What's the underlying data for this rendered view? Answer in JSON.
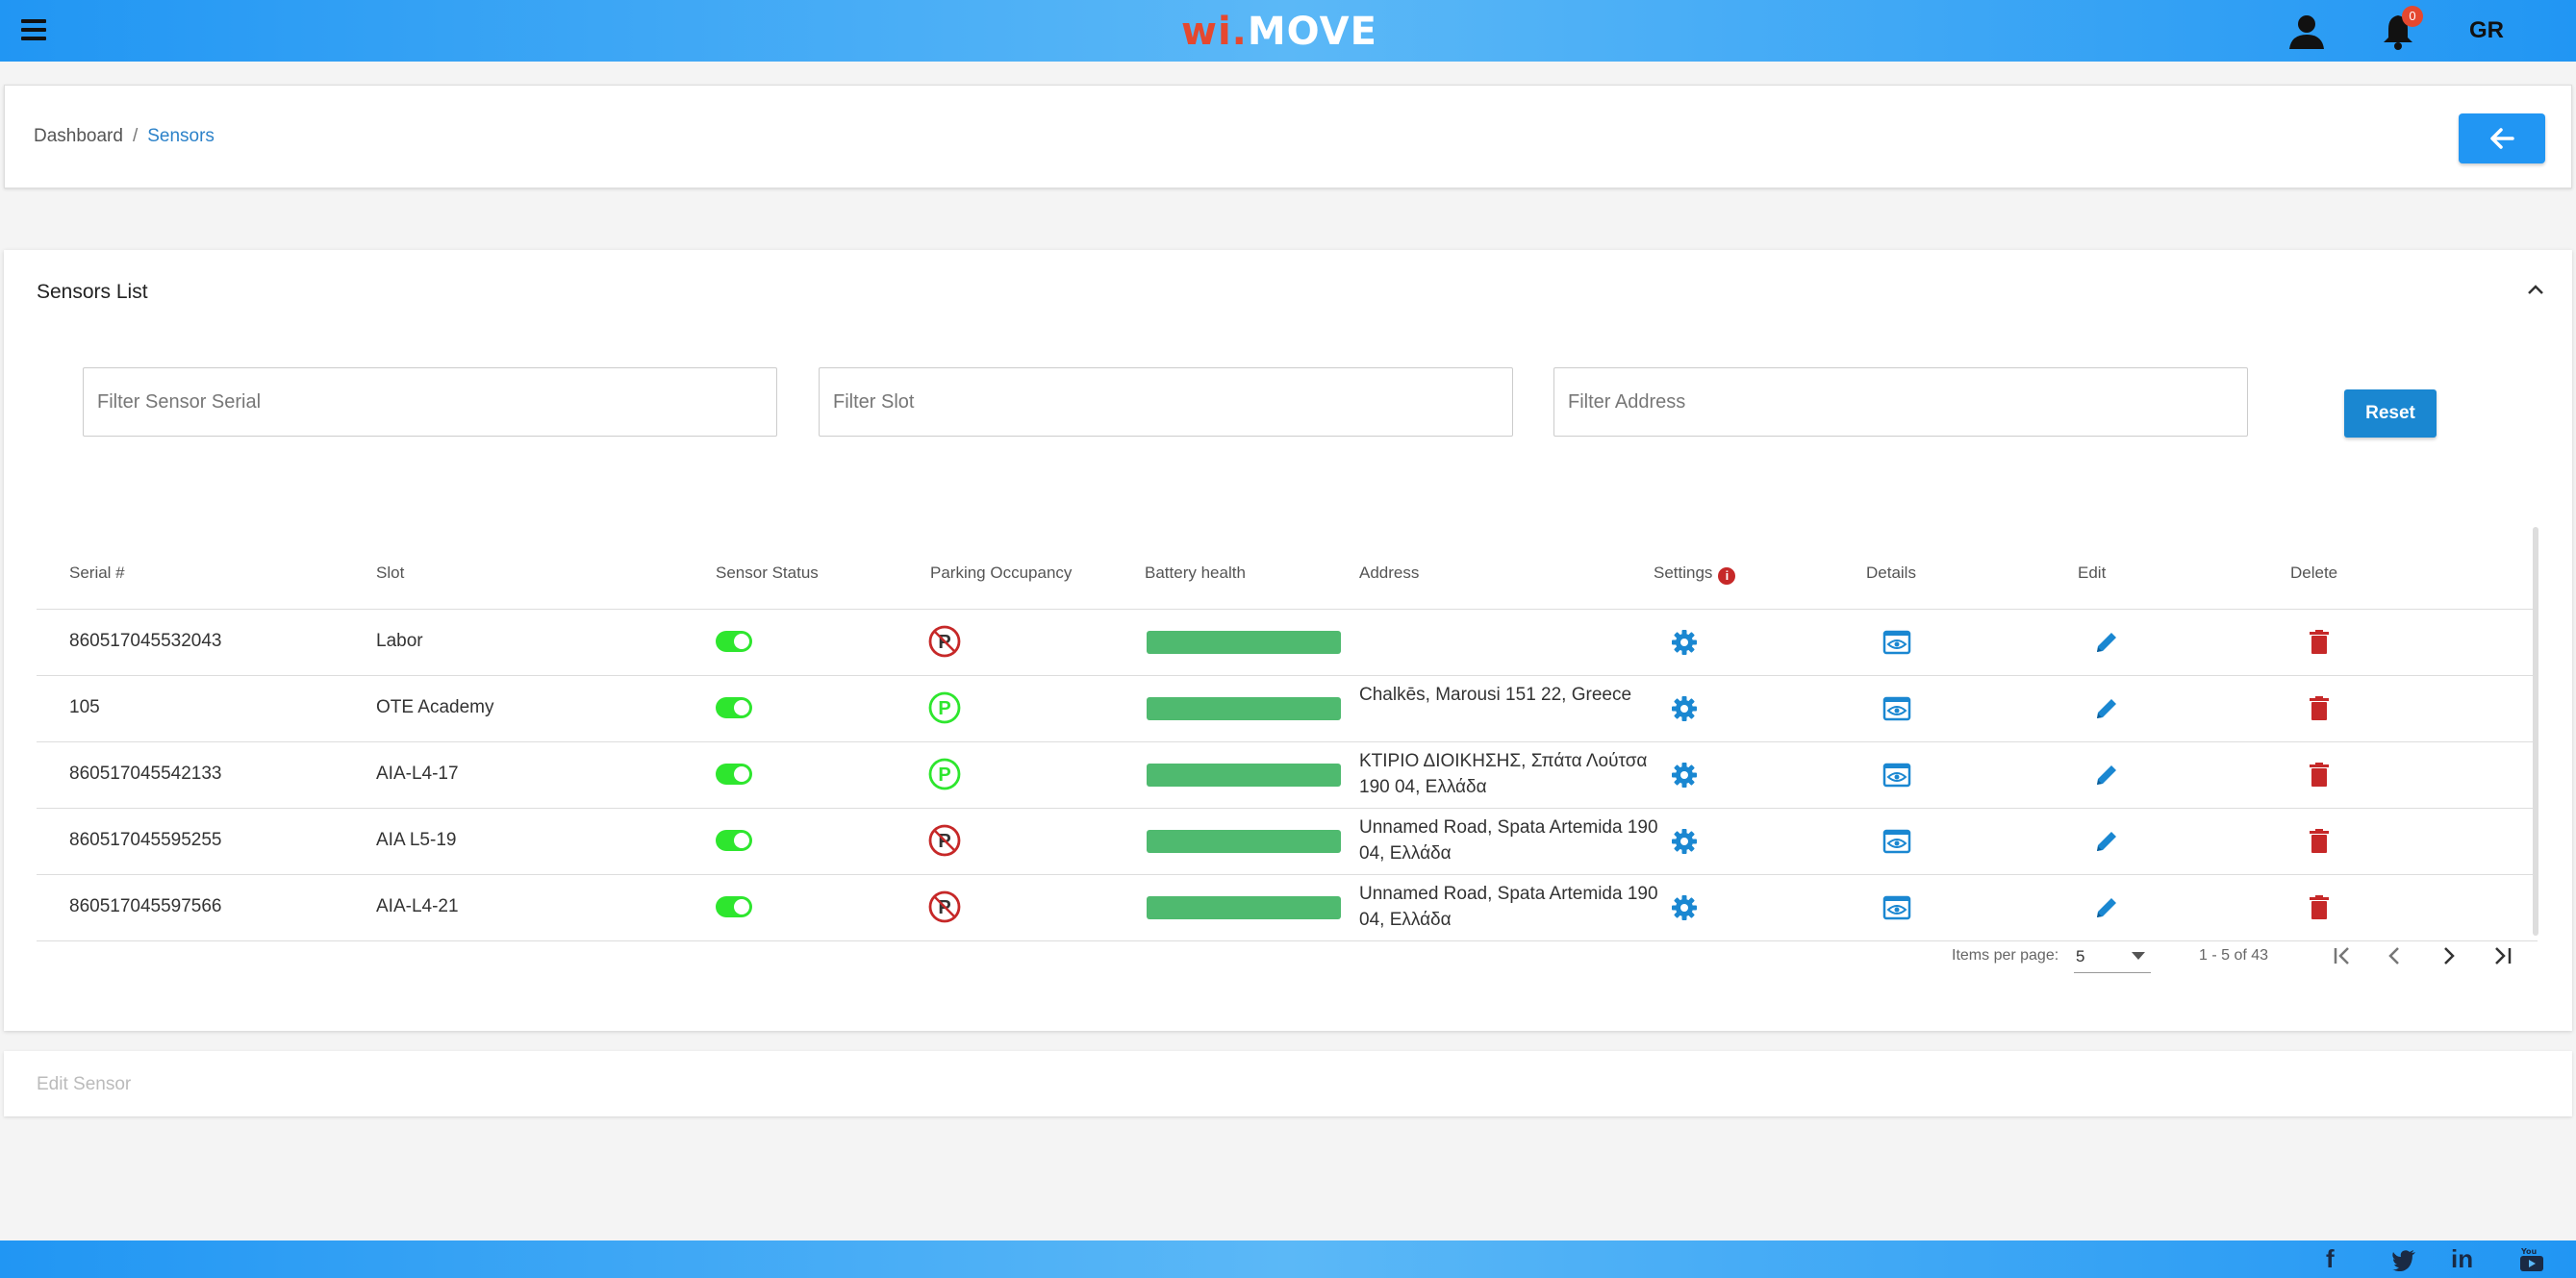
{
  "app": {
    "logo_wi": "wi",
    "logo_dot": ".",
    "logo_move": "MOVE",
    "notification_count": "0",
    "language": "GR"
  },
  "breadcrumb": {
    "home": "Dashboard",
    "separator": "/",
    "current": "Sensors"
  },
  "sensors_list": {
    "title": "Sensors List",
    "filters": {
      "serial_placeholder": "Filter Sensor Serial",
      "slot_placeholder": "Filter Slot",
      "address_placeholder": "Filter Address",
      "reset_label": "Reset"
    },
    "columns": {
      "serial": "Serial #",
      "slot": "Slot",
      "status": "Sensor Status",
      "occupancy": "Parking Occupancy",
      "battery": "Battery health",
      "address": "Address",
      "settings": "Settings",
      "settings_info": "i",
      "details": "Details",
      "edit": "Edit",
      "delete": "Delete"
    },
    "rows": [
      {
        "serial": "860517045532043",
        "slot": "Labor",
        "status": "on",
        "occupancy": "occupied",
        "battery": 1.0,
        "address": ""
      },
      {
        "serial": "105",
        "slot": "OTE Academy",
        "status": "on",
        "occupancy": "free",
        "battery": 1.0,
        "address": "Chalkēs, Marousi 151 22, Greece"
      },
      {
        "serial": "860517045542133",
        "slot": "AIA-L4-17",
        "status": "on",
        "occupancy": "free",
        "battery": 1.0,
        "address": "ΚΤΙΡΙΟ ΔΙΟΙΚΗΣΗΣ, Σπάτα Λούτσα 190 04, Ελλάδα"
      },
      {
        "serial": "860517045595255",
        "slot": "AIA L5-19",
        "status": "on",
        "occupancy": "occupied",
        "battery": 1.0,
        "address": "Unnamed Road, Spata Artemida 190 04, Ελλάδα"
      },
      {
        "serial": "860517045597566",
        "slot": "AIA-L4-21",
        "status": "on",
        "occupancy": "occupied",
        "battery": 1.0,
        "address": "Unnamed Road, Spata Artemida 190 04, Ελλάδα"
      }
    ],
    "pagination": {
      "items_per_page_label": "Items per page:",
      "items_per_page": "5",
      "range": "1 - 5 of 43"
    }
  },
  "edit_sensor": {
    "title": "Edit Sensor"
  },
  "colors": {
    "primary": "#2196f3",
    "battery": "#4fba6f",
    "toggle_on": "#2ee62e",
    "occupied": "#c62828",
    "free": "#2ee62e",
    "delete": "#c62828",
    "action": "#1a87d1"
  },
  "footer": {
    "social": [
      "facebook-icon",
      "twitter-icon",
      "linkedin-icon",
      "youtube-icon"
    ]
  }
}
